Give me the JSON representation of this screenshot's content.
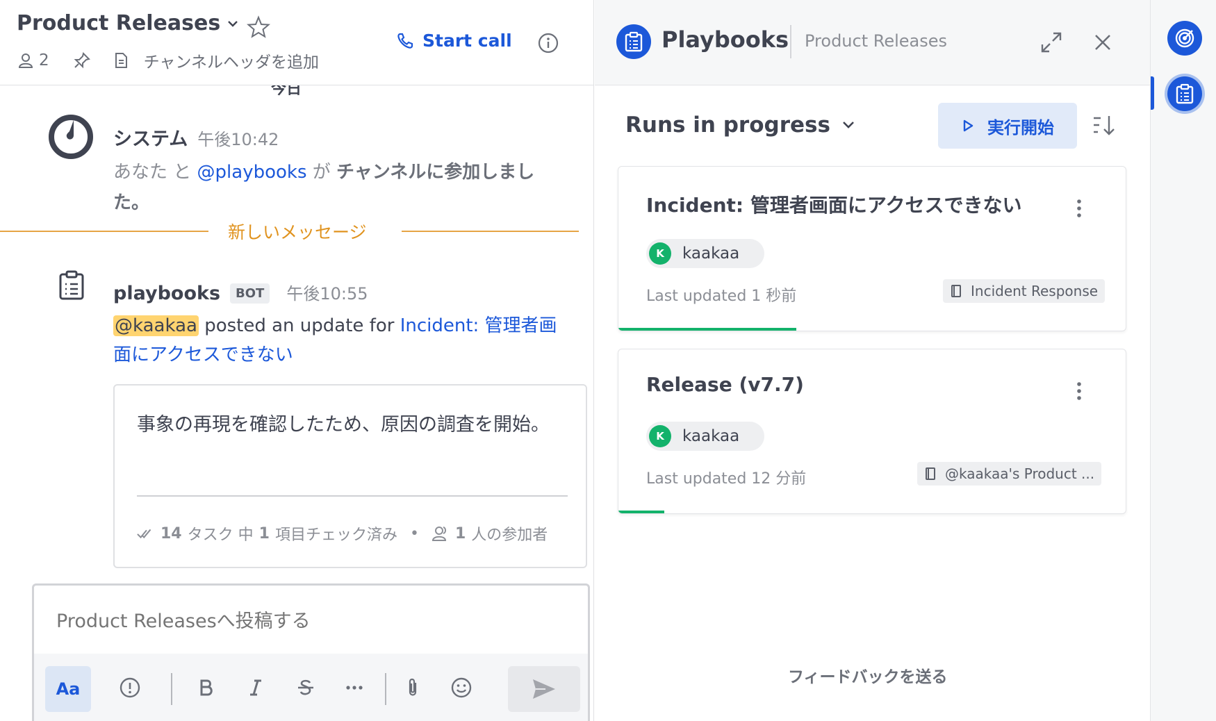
{
  "channel": {
    "title": "Product Releases",
    "member_count": "2",
    "header_placeholder": "チャンネルヘッダを追加",
    "start_call": "Start call",
    "date_separator": "今日"
  },
  "system_post": {
    "author": "システム",
    "time": "午後10:42",
    "text_you": "あなた",
    "text_and": " と ",
    "mention": "@playbooks",
    "text_ga": " が ",
    "text_joined": "チャンネルに参加しました。"
  },
  "new_messages": "新しいメッセージ",
  "bot_post": {
    "author": "playbooks",
    "badge": "BOT",
    "time": "午後10:55",
    "mention": "@kaakaa",
    "text": " posted an update for ",
    "link": "Incident: 管理者画面にアクセスできない",
    "update_text": "事象の再現を確認したため、原因の調査を開始。",
    "tasks_count": "14",
    "tasks_text": "タスク 中",
    "checked_count": "1",
    "checked_text": "項目チェック済み",
    "participants_count": "1",
    "participants_text": "人の参加者"
  },
  "composer": {
    "placeholder": "Product Releasesへ投稿する",
    "format_label": "Aa"
  },
  "rhs": {
    "title": "Playbooks",
    "subtitle": "Product Releases",
    "filter": "Runs in progress",
    "start_run": "実行開始",
    "runs": [
      {
        "title": "Incident: 管理者画面にアクセスできない",
        "owner": "kaakaa",
        "owner_initial": "K",
        "last_updated": "Last updated 1 秒前",
        "playbook": "Incident Response",
        "progress": 0.35
      },
      {
        "title": "Release (v7.7)",
        "owner": "kaakaa",
        "owner_initial": "K",
        "last_updated": "Last updated 12 分前",
        "playbook": "@kaakaa's Product ...",
        "progress": 0.09
      }
    ],
    "feedback": "フィードバックを送る"
  },
  "colors": {
    "accent": "#1c58d9",
    "progress": "#13b26b",
    "new_message_line": "#e6a545",
    "mention_highlight": "#ffd470"
  }
}
